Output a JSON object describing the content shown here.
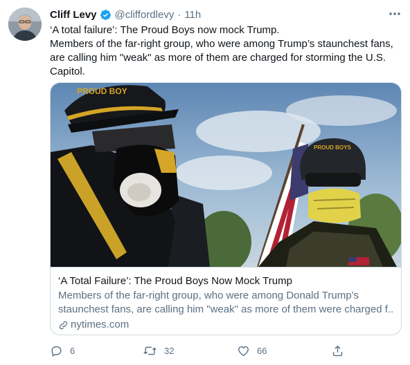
{
  "tweet": {
    "display_name": "Cliff Levy",
    "handle": "@cliffordlevy",
    "separator": "·",
    "time": "11h",
    "text_lines": [
      "‘A total failure’: The Proud Boys now mock Trump.",
      "Members of the far-right group, who were among Trump’s staunchest fans,",
      "are calling him \"weak\" as more of them are charged for storming the U.S.",
      "Capitol."
    ]
  },
  "card": {
    "title": "‘A Total Failure’: The Proud Boys Now Mock Trump",
    "description_lines": [
      "Members of the far-right group, who were among Donald Trump’s",
      "staunchest fans, are calling him \"weak\" as more of them were charged f..."
    ],
    "domain": "nytimes.com",
    "image_text": {
      "helmet_left": "PROUD BOY",
      "helmet_right": "PROUD BOYS"
    }
  },
  "actions": {
    "reply_count": "6",
    "retweet_count": "32",
    "like_count": "66"
  },
  "icons": {
    "verified": "verified-badge-icon",
    "more": "more-horizontal-icon",
    "reply": "reply-icon",
    "retweet": "retweet-icon",
    "like": "heart-icon",
    "share": "share-icon",
    "link": "link-icon"
  },
  "colors": {
    "accent": "#1da1f2",
    "secondary_text": "#5b7083",
    "border": "#cfd9de"
  }
}
